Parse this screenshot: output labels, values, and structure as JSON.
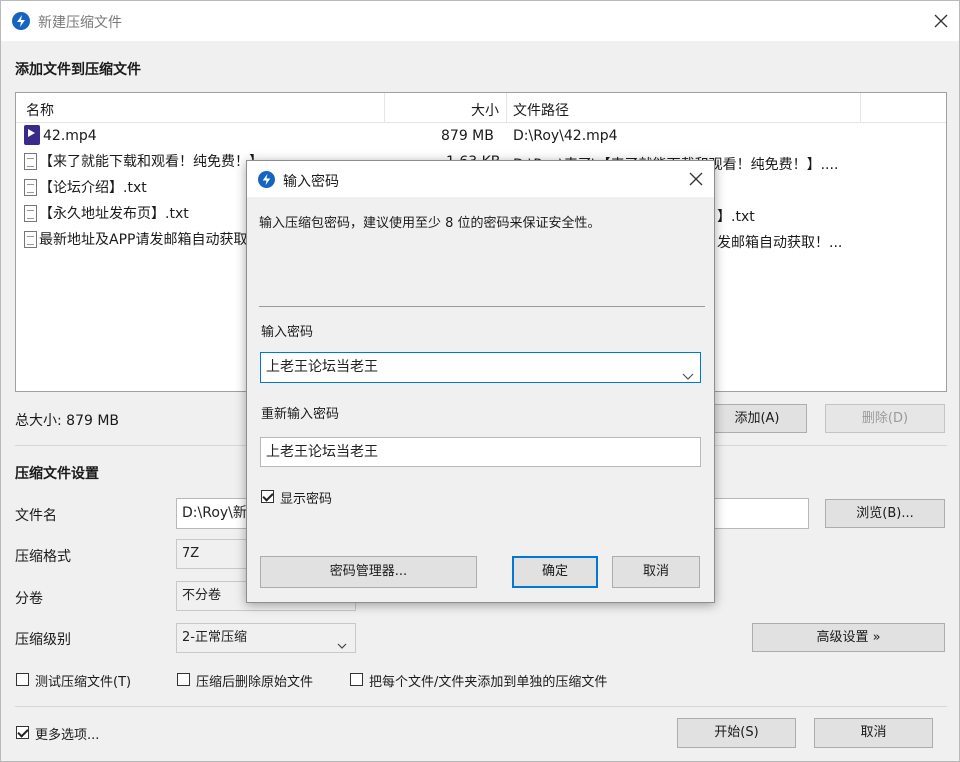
{
  "window": {
    "title": "新建压缩文件"
  },
  "files_section": {
    "heading": "添加文件到压缩文件",
    "columns": [
      "名称",
      "大小",
      "文件路径"
    ],
    "rows": [
      {
        "name": "42.mp4",
        "size": "879 MB",
        "path": "D:\\Roy\\42.mp4",
        "icon": "video-file-icon"
      },
      {
        "name": "【来了就能下载和观看！纯免费！】.txt",
        "size": "1.63 KB",
        "path": "D:\\Roy\\来了\\【来了就能下载和观看！纯免费！】....",
        "icon": "text-file-icon"
      },
      {
        "name": "【论坛介绍】.txt",
        "size": "",
        "path": "",
        "icon": "text-file-icon"
      },
      {
        "name": "【永久地址发布页】.txt",
        "size": "",
        "path": "】.txt",
        "icon": "text-file-icon"
      },
      {
        "name": "最新地址及APP请发邮箱自动获取！.txt",
        "size": "",
        "path": "发邮箱自动获取！...",
        "icon": "text-file-icon"
      }
    ],
    "total_label": "总大小: 879 MB",
    "add_button": "添加(A)",
    "delete_button": "删除(D)"
  },
  "settings": {
    "heading": "压缩文件设置",
    "filename_label": "文件名",
    "filename_value": "D:\\Roy\\新",
    "browse_button": "浏览(B)...",
    "format_label": "压缩格式",
    "format_value": "7Z",
    "split_label": "分卷",
    "split_value": "不分卷",
    "level_label": "压缩级别",
    "level_value": "2-正常压缩",
    "advanced_button": "高级设置 »",
    "test_checkbox": "测试压缩文件(T)",
    "delete_after_checkbox": "压缩后删除原始文件",
    "separate_checkbox": "把每个文件/文件夹添加到单独的压缩文件",
    "more_options_checkbox": "更多选项...",
    "start_button": "开始(S)",
    "cancel_button": "取消"
  },
  "dialog": {
    "title": "输入密码",
    "description": "输入压缩包密码，建议使用至少 8 位的密码来保证安全性。",
    "password_label": "输入密码",
    "password_value": "上老王论坛当老王",
    "reenter_label": "重新输入密码",
    "reenter_value": "上老王论坛当老王",
    "show_password_checkbox": "显示密码",
    "show_password_checked": true,
    "manager_button": "密码管理器...",
    "ok_button": "确定",
    "cancel_button": "取消"
  },
  "colors": {
    "app_icon": "#1565c0",
    "focus_border": "#0078d7"
  }
}
